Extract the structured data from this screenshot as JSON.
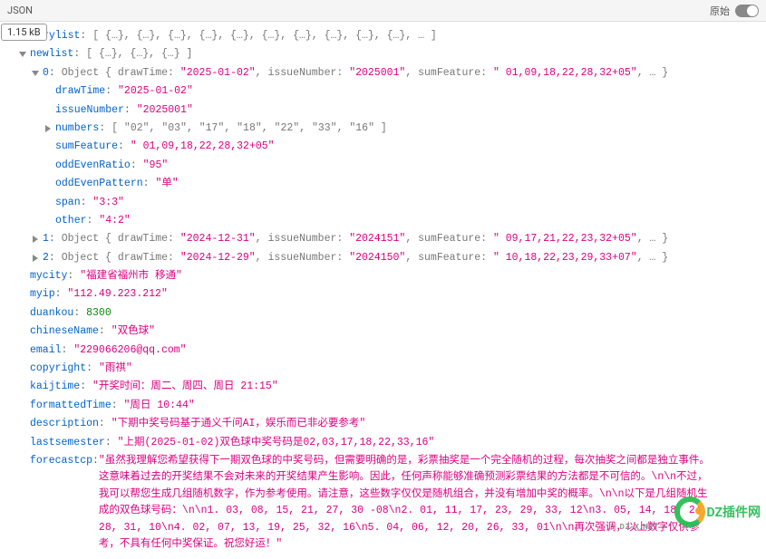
{
  "toolbar": {
    "tab": "JSON",
    "raw_label": "原始"
  },
  "size_badge": "1.15 kB",
  "tree": {
    "rylist_key": "rylist",
    "rylist_preview": "[ {…}, {…}, {…}, {…}, {…}, {…}, {…}, {…}, {…}, {…}, … ]",
    "newlist_key": "newlist",
    "newlist_preview": "[ {…}, {…}, {…} ]",
    "item0_key": "0",
    "item0_preview_a": "Object { drawTime: ",
    "item0_drawTime_v": "\"2025-01-02\"",
    "item0_preview_b": ", issueNumber: ",
    "item0_issueNumber_v": "\"2025001\"",
    "item0_preview_c": ", sumFeature: ",
    "item0_sumFeature_v": "\" 01,09,18,22,28,32+05\"",
    "item0_preview_d": ", … }",
    "drawTime_key": "drawTime",
    "drawTime_val": "\"2025-01-02\"",
    "issueNumber_key": "issueNumber",
    "issueNumber_val": "\"2025001\"",
    "numbers_key": "numbers",
    "numbers_val": "[ \"02\", \"03\", \"17\", \"18\", \"22\", \"33\", \"16\" ]",
    "sumFeature_key": "sumFeature",
    "sumFeature_val": "\" 01,09,18,22,28,32+05\"",
    "oddEvenRatio_key": "oddEvenRatio",
    "oddEvenRatio_val": "\"95\"",
    "oddEvenPattern_key": "oddEvenPattern",
    "oddEvenPattern_val": "\"单\"",
    "span_key": "span",
    "span_val": "\"3:3\"",
    "other_key": "other",
    "other_val": "\"4:2\"",
    "item1_key": "1",
    "item1_preview_a": "Object { drawTime: ",
    "item1_drawTime_v": "\"2024-12-31\"",
    "item1_preview_b": ", issueNumber: ",
    "item1_issueNumber_v": "\"2024151\"",
    "item1_preview_c": ", sumFeature: ",
    "item1_sumFeature_v": "\" 09,17,21,22,23,32+05\"",
    "item1_preview_d": ", … }",
    "item2_key": "2",
    "item2_preview_a": "Object { drawTime: ",
    "item2_drawTime_v": "\"2024-12-29\"",
    "item2_preview_b": ", issueNumber: ",
    "item2_issueNumber_v": "\"2024150\"",
    "item2_preview_c": ", sumFeature: ",
    "item2_sumFeature_v": "\" 10,18,22,23,29,33+07\"",
    "item2_preview_d": ", … }",
    "mycity_key": "mycity",
    "mycity_val": "\"福建省福州市 移通\"",
    "myip_key": "myip",
    "myip_val": "\"112.49.223.212\"",
    "duankou_key": "duankou",
    "duankou_val": "8300",
    "chineseName_key": "chineseName",
    "chineseName_val": "\"双色球\"",
    "email_key": "email",
    "email_val": "\"229066206@qq.com\"",
    "copyright_key": "copyright",
    "copyright_val": "\"雨祺\"",
    "kaijtime_key": "kaijtime",
    "kaijtime_val": "\"开奖时间：周二、周四、周日 21:15\"",
    "formattedTime_key": "formattedTime",
    "formattedTime_val": "\"周日 10:44\"",
    "description_key": "description",
    "description_val": "\"下期中奖号码基于通义千问AI，娱乐而已非必要参考\"",
    "lastsemester_key": "lastsemester",
    "lastsemester_val": "\"上期(2025-01-02)双色球中奖号码是02,03,17,18,22,33,16\"",
    "forecastcp_key": "forecastcp",
    "forecastcp_val": "\"虽然我理解您希望获得下一期双色球的中奖号码，但需要明确的是，彩票抽奖是一个完全随机的过程，每次抽奖之间都是独立事件。这意味着过去的开奖结果不会对未来的开奖结果产生影响。因此，任何声称能够准确预测彩票结果的方法都是不可信的。\\n\\n不过，我可以帮您生成几组随机数字，作为参考使用。请注意，这些数字仅仅是随机组合，并没有增加中奖的概率。\\n\\n以下是几组随机生成的双色球号码：\\n\\n1. 03, 08, 15, 21, 27, 30 -08\\n2. 01, 11, 17, 23, 29, 33, 12\\n3. 05, 14, 18, 24, 28, 31, 10\\n4. 02, 07, 13, 19, 25, 32, 16\\n5. 04, 06, 12, 20, 26, 33, 01\\n\\n再次强调，以上数字仅供参考，不具有任何中奖保证。祝您好运！\""
  },
  "watermark": {
    "text1": "DZ插件网",
    "text2": "",
    "sub": "— DZ-X.NET —"
  }
}
